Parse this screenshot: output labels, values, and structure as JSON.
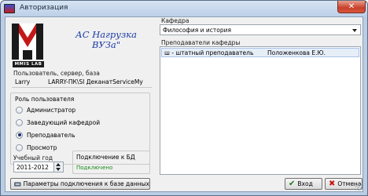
{
  "window": {
    "title": "Авторизация",
    "close_glyph": "✕"
  },
  "logo": {
    "sub": "MMIS LAB",
    "app_title_line1": "АС Нагрузка",
    "app_title_line2": "ВУЗа\""
  },
  "server": {
    "label": "Пользователь, сервер, база",
    "user": "Larry",
    "connection": "LARRY-ПК\\SI ДеканатServiceMy"
  },
  "role": {
    "title": "Роль пользователя",
    "options": [
      {
        "label": "Администратор",
        "checked": false
      },
      {
        "label": "Заведующий кафедрой",
        "checked": false
      },
      {
        "label": "Преподаватель",
        "checked": true
      },
      {
        "label": "Просмотр",
        "checked": false
      }
    ]
  },
  "year": {
    "label": "Учебный год",
    "value": "2011-2012"
  },
  "db": {
    "title": "Подключение к БД",
    "status": "Подключено"
  },
  "buttons": {
    "params": "Параметры подключения к базе данных",
    "login": "Вход",
    "cancel": "Отмена"
  },
  "kafedra": {
    "label": "Кафедра",
    "value": "Философия и история"
  },
  "teachers": {
    "label": "Преподаватели кафедры",
    "rows": [
      {
        "status": "ш - штатный преподаватель",
        "name": "Положенкова Е.Ю."
      }
    ]
  },
  "icons": {
    "app": "app-icon",
    "logo": "mmis-logo-icon",
    "params": "connection-settings-icon",
    "login": "check-icon",
    "cancel": "cross-icon"
  }
}
